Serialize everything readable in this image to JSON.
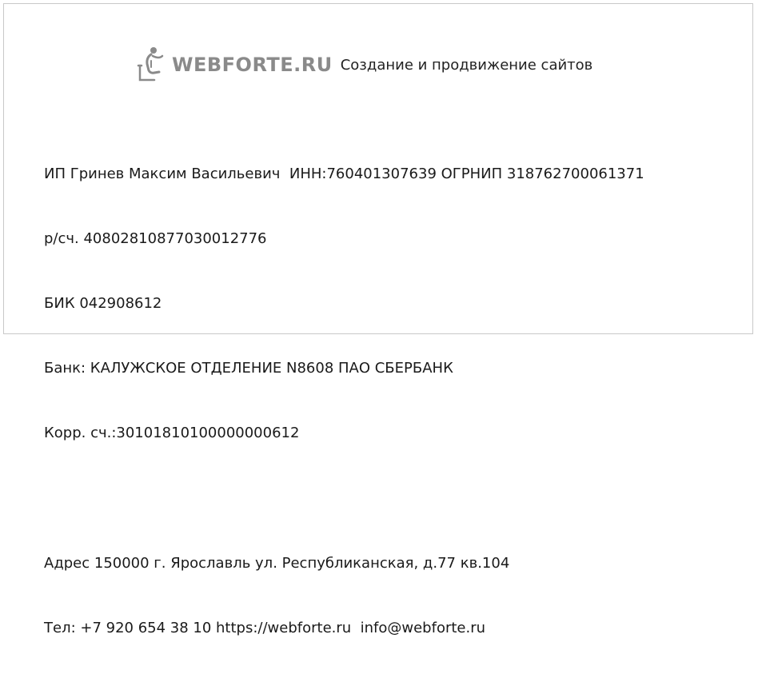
{
  "header": {
    "brand": "WEBFORTE.RU",
    "tagline": "Создание и продвижение сайтов",
    "logo_icon": "person-with-laptop-icon"
  },
  "details": {
    "line1": "ИП Гринев Максим Васильевич  ИНН:760401307639 ОГРНИП 318762700061371",
    "line2": "р/сч. 40802810877030012776",
    "line3": "БИК 042908612",
    "line4": "Банк: КАЛУЖСКОЕ ОТДЕЛЕНИЕ N8608 ПАО СБЕРБАНК",
    "line5": "Корр. сч.:30101810100000000612",
    "address": "Адрес 150000 г. Ярославль ул. Республиканская, д.77 кв.104",
    "contacts": "Тел: +7 920 654 38 10 https://webforte.ru  info@webforte.ru"
  },
  "colors": {
    "brand": "#8a8a8a",
    "text": "#1a1a1a",
    "border": "#c9c9c9"
  }
}
